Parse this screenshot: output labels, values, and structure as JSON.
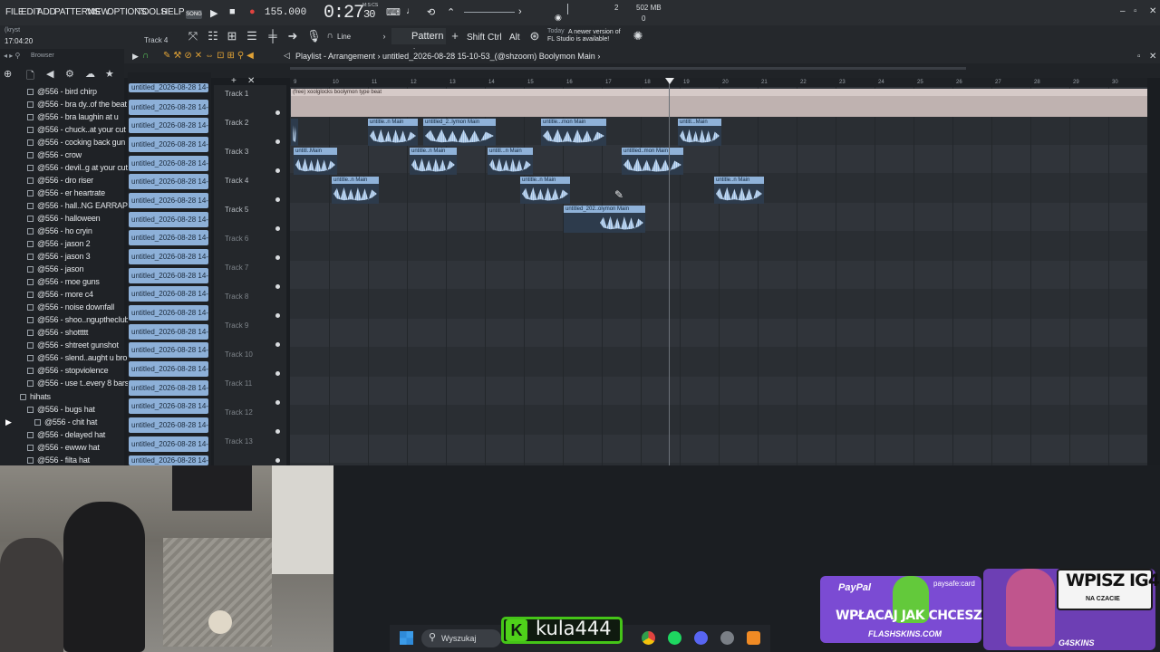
{
  "menu": [
    "FILE",
    "EDIT",
    "ADD",
    "PATTERNS",
    "VIEW",
    "OPTIONS",
    "TOOLS",
    "HELP"
  ],
  "transport": {
    "song_label": "SONG",
    "tempo": "155.000",
    "time": "0:27",
    "time_small": "30",
    "time_mode": "M:S:CS",
    "memory": "502 MB",
    "polyphony": "0",
    "cpu_top": "2"
  },
  "toolbar2": {
    "user": "(kryst",
    "clock": "17:04:20",
    "track": "Track 4",
    "snap": "Line",
    "pattern": "Pattern 1",
    "key_shift": "Shift",
    "key_ctrl": "Ctrl",
    "key_alt": "Alt",
    "news_day": "Today",
    "news_line1": "A newer version of",
    "news_line2": "FL Studio is available!"
  },
  "browser": {
    "title": "Browser",
    "items": [
      {
        "label": "@556 - bird chirp"
      },
      {
        "label": "@556 - bra dy..of the beat"
      },
      {
        "label": "@556 - bra laughin at u"
      },
      {
        "label": "@556 - chuck..at your cut"
      },
      {
        "label": "@556 - cocking back gun"
      },
      {
        "label": "@556 - crow"
      },
      {
        "label": "@556 - devil..g at your cut"
      },
      {
        "label": "@556 - dro riser"
      },
      {
        "label": "@556 - er heartrate"
      },
      {
        "label": "@556 - hall..NG EARRAPE)"
      },
      {
        "label": "@556 - halloween"
      },
      {
        "label": "@556 - ho cryin"
      },
      {
        "label": "@556 - jason 2"
      },
      {
        "label": "@556 - jason 3"
      },
      {
        "label": "@556 - jason"
      },
      {
        "label": "@556 - moe guns"
      },
      {
        "label": "@556 - more c4"
      },
      {
        "label": "@556 - noise downfall"
      },
      {
        "label": "@556 - shoo..ngupthecIub"
      },
      {
        "label": "@556 - shottttt"
      },
      {
        "label": "@556 - shtreet gunshot"
      },
      {
        "label": "@556 - slend..aught u bro"
      },
      {
        "label": "@556 - stopviolence"
      },
      {
        "label": "@556 - use t..every 8 bars"
      }
    ],
    "folder": "hihats",
    "sub_items": [
      {
        "label": "@556 - bugs hat"
      },
      {
        "label": "@556 - chit hat"
      },
      {
        "label": "@556 - delayed hat"
      },
      {
        "label": "@556 - ewww hat"
      },
      {
        "label": "@556 - filta hat"
      }
    ]
  },
  "playlist": {
    "title": "Playlist - Arrangement",
    "song": "untitled_2026-08-28 15-10-53_(@shzoom) Boolymon Main",
    "ruler": [
      "9",
      "10",
      "11",
      "12",
      "13",
      "14",
      "15",
      "16",
      "17",
      "18",
      "19",
      "20",
      "21",
      "22",
      "23",
      "24",
      "25",
      "26",
      "27",
      "28",
      "29",
      "30"
    ],
    "clip_list": [
      "untitled_2026-08-28 14-",
      "untitled_2026-08-28 14-",
      "untitled_2026-08-28 14-",
      "untitled_2026-08-28 14-",
      "untitled_2026-08-28 14-",
      "untitled_2026-08-28 14-",
      "untitled_2026-08-28 14-",
      "untitled_2026-08-28 14-",
      "untitled_2026-08-28 14-",
      "untitled_2026-08-28 14-",
      "untitled_2026-08-28 14-",
      "untitled_2026-08-28 14-",
      "untitled_2026-08-28 14-",
      "untitled_2026-08-28 14-",
      "untitled_2026-08-28 14-",
      "untitled_2026-08-28 14-",
      "untitled_2026-08-28 14-",
      "untitled_2026-08-28 14-",
      "untitled_2026-08-28 14-",
      "untitled_2026-08-28 14-",
      "untitled_2026-08-28 14-"
    ],
    "tracks": [
      "Track 1",
      "Track 2",
      "Track 3",
      "Track 4",
      "Track 5",
      "Track 6",
      "Track 7",
      "Track 8",
      "Track 9",
      "Track 10",
      "Track 11",
      "Track 12",
      "Track 13"
    ],
    "main_clip": "(free) xoolglocks boolymon type beat",
    "clips": [
      {
        "label": "untitle..n Main"
      },
      {
        "label": "untitled_2..lymon Main"
      },
      {
        "label": "untitle...mon Main"
      },
      {
        "label": "untitl...Main"
      },
      {
        "label": "untitl..Main"
      },
      {
        "label": "untitle..n Main"
      },
      {
        "label": "untitl...n Main"
      },
      {
        "label": "untitled..mon Main"
      },
      {
        "label": "untitle..n Main"
      },
      {
        "label": "untitle..n Main"
      },
      {
        "label": "untitle..n Main"
      },
      {
        "label": "untitled_202..olymon Main"
      }
    ]
  },
  "taskbar": {
    "search": "Wyszukaj",
    "streamer": "kula444"
  },
  "ads": {
    "paypal": "PayPal",
    "paysafe": "paysafe:card",
    "cta": "WPŁACAJ JAK CHCESZ",
    "flashskins": "FLASHSKINS.COM",
    "wpisz": "WPISZ IG4",
    "na_czacie": "NA CZACIE",
    "g4skins": "G4SKINS"
  }
}
